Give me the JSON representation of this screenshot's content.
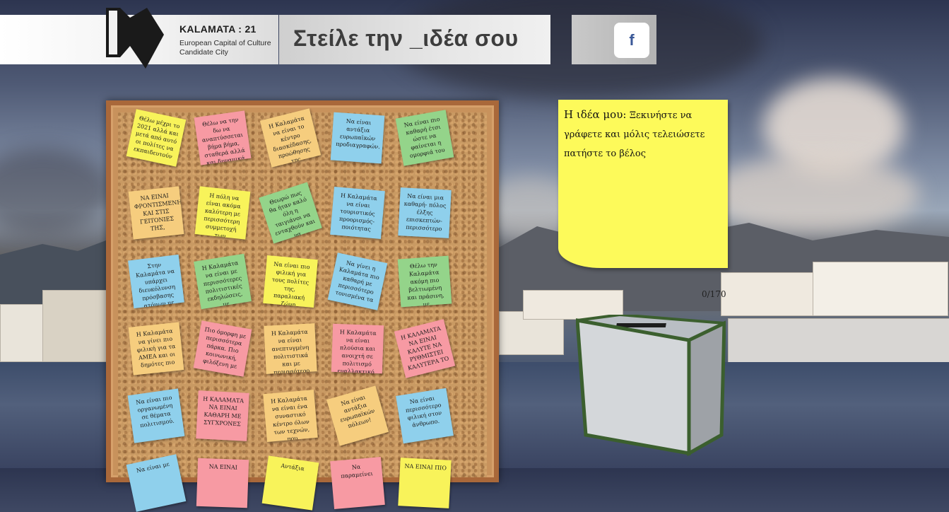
{
  "brand": {
    "name": "KALAMATA : 21",
    "sub1": "European Capital of Culture",
    "sub2": "Candidate City"
  },
  "header": {
    "title": "Στείλε την _ιδέα σου"
  },
  "social": {
    "facebook_label": "f"
  },
  "notes": [
    {
      "text": "Θέλω μέχρι το 2021 αλλά και μετά από αυτό οι πολίτες να εκπαιδευτούν",
      "color": "n-yellow"
    },
    {
      "text": "Θέλω να την δω να αναπτύσσεται βήμα βήμα, σταθερά αλλά και δυναμικά",
      "color": "n-pink"
    },
    {
      "text": "Η Καλαμάτα να είναι το κέντρο διασκέδασης, προώθησης της ευρωπαϊκής",
      "color": "n-orange"
    },
    {
      "text": "Να είναι αντάξια ευρωπαϊκών προδιαγραφών.",
      "color": "n-blue"
    },
    {
      "text": "Να είναι πιο καθαρή έτσι ώστε να φαίνεται η ομορφιά του",
      "color": "n-green"
    },
    {
      "text": "ΝΑ ΕΙΝΑΙ ΦΡΟΝΤΙΣΜΕΝΗ ΚΑΙ ΣΤΙΣ ΓΕΙΤΟΝΙΕΣ ΤΗΣ,",
      "color": "n-orange"
    },
    {
      "text": "Η πόλη να είναι ακόμα καλύτερη με περισσότερη συμμετοχή των",
      "color": "n-yellow"
    },
    {
      "text": "Θεωρώ πως θα ήταν καλό όλη η ταιγιάνοι να ενταχθούν και να",
      "color": "n-green"
    },
    {
      "text": "Η Καλαμάτα να είναι τουριστικός προορισμός- ποιότητας",
      "color": "n-blue"
    },
    {
      "text": "Να είναι μια καθαρή- πόλος έλξης επισκεπτών- περισσότερο",
      "color": "n-blue"
    },
    {
      "text": "Στην Καλαμάτα να υπάρχει διευκόλυνση πρόσβασης ατόμων με",
      "color": "n-blue"
    },
    {
      "text": "Η Καλαμάτα να είναι με περισσότερες πολιτιστικές εκδηλώσεις, με",
      "color": "n-green"
    },
    {
      "text": "Να είναι πιο φιλική για τους πολίτες της, παραλιακή ζώνη",
      "color": "n-yellow"
    },
    {
      "text": "Να γίνει η Καλαμάτα πιο καθαρή με περισσότερο τονισμένα τα",
      "color": "n-blue"
    },
    {
      "text": "Θέλω την Καλαμάτα ακόμη πιο βελτιωμένη και πράσινη, με",
      "color": "n-green"
    },
    {
      "text": "Η Καλαμάτα να γίνει πιο φιλική για τα ΑΜΕΑ και οι δημότες πιο",
      "color": "n-orange"
    },
    {
      "text": "Πιο όμορφη με περισσότερα πάρκα. Πιο κοινωνική, φιλόξενη με",
      "color": "n-pink"
    },
    {
      "text": "Η Καλαμάτα να είναι ανεπτυγμένη πολιτιστικά και με περισσότερο",
      "color": "n-orange"
    },
    {
      "text": "Η Καλαμάτα να είναι πλούσια και ανοιχτή σε πολιτισμό εναλλακτικό,",
      "color": "n-pink"
    },
    {
      "text": "Η ΚΑΛΑΜΑΤΑ ΝΑ ΕΙΝΑΙ ΚΑΛΥΤΕ ΝΑ ΡΥΘΜΙΣΤΕΙ ΚΑΛΥΤΕΡΑ ΤΟ",
      "color": "n-pink"
    },
    {
      "text": "Να είναι πιο οργανωμένη σε θέματα πολιτισμού.",
      "color": "n-blue"
    },
    {
      "text": "Η ΚΑΛΑΜΑΤΑ ΝΑ ΕΙΝΑΙ ΚΑΘΑΡΗ ΜΕ ΣΥΓΧΡΟΝΕΣ",
      "color": "n-pink"
    },
    {
      "text": "Η Καλαμάτα να είναι ένα συναστικό κέντρο όλων των τεχνών, που",
      "color": "n-orange"
    },
    {
      "text": "Να είναι αντάξια ευρωπαϊκών πόλεων!",
      "color": "n-orange"
    },
    {
      "text": "Να είναι περισσότερο φιλική στον άνθρωπο.",
      "color": "n-blue"
    },
    {
      "text": "Να είναι με",
      "color": "n-blue"
    },
    {
      "text": "ΝΑ ΕΙΝΑΙ",
      "color": "n-pink"
    },
    {
      "text": "Αντάξια",
      "color": "n-yellow"
    },
    {
      "text": "Να παραμείνει",
      "color": "n-pink"
    },
    {
      "text": "ΝΑ ΕΙΝΑΙ ΠΙΟ",
      "color": "n-yellow"
    }
  ],
  "idea": {
    "label": "Η ιδέα μου:",
    "placeholder": "Ξεκινήστε να γράφετε και μόλις τελειώσετε πατήστε το βέλος",
    "counter": "0/170"
  }
}
